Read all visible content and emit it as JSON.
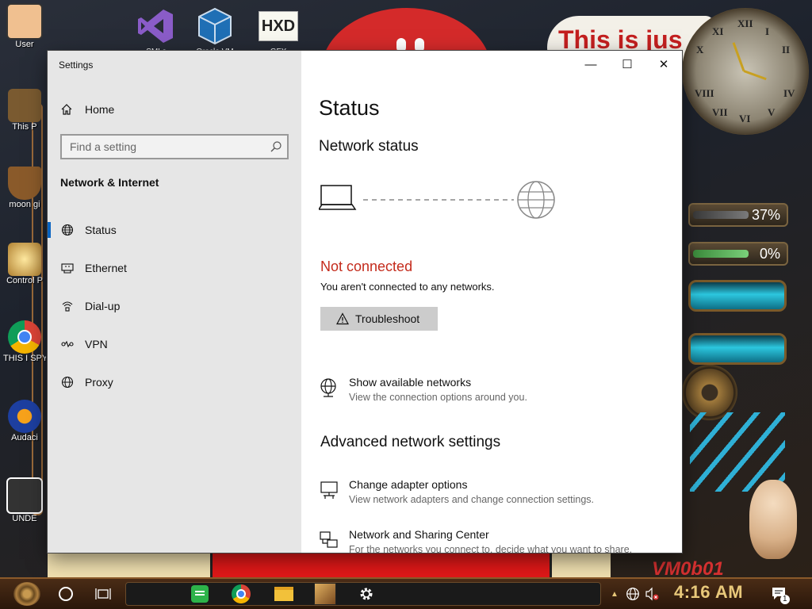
{
  "desktop": {
    "icons": [
      {
        "label": "User"
      },
      {
        "label": "This P"
      },
      {
        "label": "moon gi"
      },
      {
        "label": "Control P"
      },
      {
        "label": "THIS I SPYWA"
      },
      {
        "label": "Audaci"
      },
      {
        "label": "UNDE"
      }
    ],
    "top_icons": [
      {
        "label": "SMLs"
      },
      {
        "label": "Oracle VM"
      },
      {
        "label": "GFX"
      }
    ],
    "banner_text": "This is jus",
    "gauges": [
      {
        "value": "37%",
        "level": 0.6
      },
      {
        "value": "0%",
        "level": 0.6
      }
    ],
    "vm_text": "VM0b01",
    "clock_numerals": [
      "XII",
      "I",
      "II",
      "IV",
      "V",
      "VI",
      "VII",
      "VIII",
      "X",
      "XI"
    ]
  },
  "window": {
    "title": "Settings",
    "controls": {
      "minimize": "—",
      "maximize": "☐",
      "close": "✕"
    }
  },
  "nav": {
    "home_label": "Home",
    "search_placeholder": "Find a setting",
    "section_title": "Network & Internet",
    "items": [
      {
        "label": "Status",
        "icon": "globe-status-icon",
        "selected": true
      },
      {
        "label": "Ethernet",
        "icon": "ethernet-icon",
        "selected": false
      },
      {
        "label": "Dial-up",
        "icon": "dial-up-icon",
        "selected": false
      },
      {
        "label": "VPN",
        "icon": "vpn-icon",
        "selected": false
      },
      {
        "label": "Proxy",
        "icon": "globe-icon",
        "selected": false
      }
    ]
  },
  "content": {
    "title": "Status",
    "network_status_heading": "Network status",
    "connection_state": "Not connected",
    "connection_detail": "You aren't connected to any networks.",
    "troubleshoot_label": "Troubleshoot",
    "show_networks": {
      "title": "Show available networks",
      "desc": "View the connection options around you."
    },
    "advanced_heading": "Advanced network settings",
    "change_adapter": {
      "title": "Change adapter options",
      "desc": "View network adapters and change connection settings."
    },
    "sharing_center": {
      "title": "Network and Sharing Center",
      "desc": "For the networks you connect to, decide what you want to share."
    }
  },
  "taskbar": {
    "clock": "4:16 AM",
    "notification_count": "1"
  },
  "colors": {
    "accent": "#0a64c2",
    "error": "#c42b1c",
    "nav_bg": "#e6e6e6",
    "taskbar_bg": "#3a2210",
    "clock_text": "#e8c87a"
  }
}
